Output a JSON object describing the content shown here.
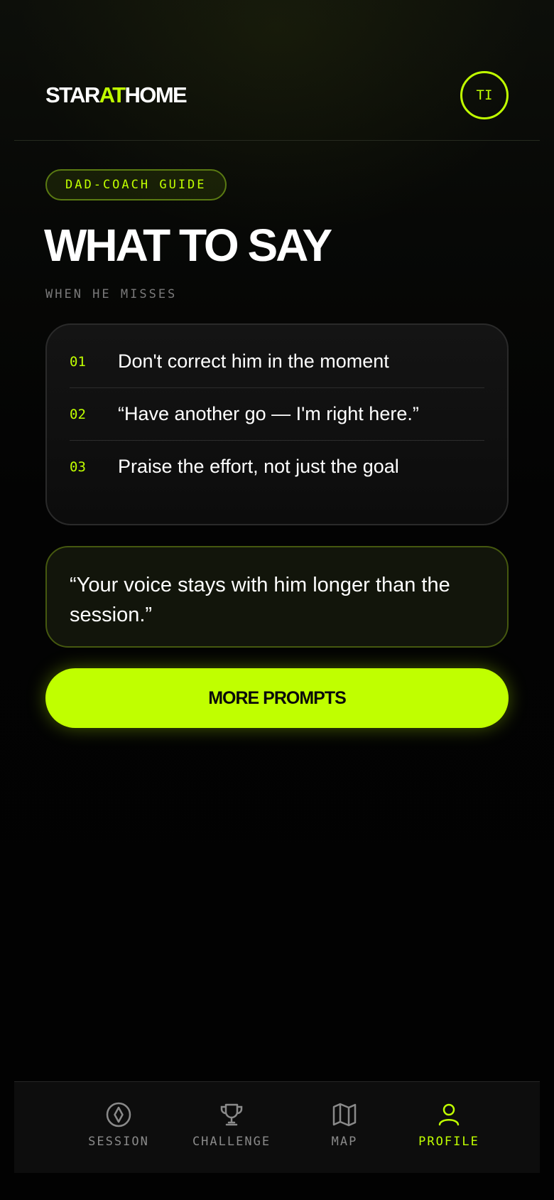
{
  "colors": {
    "accent": "#c0ff00",
    "background": "#030303",
    "muted_text": "#8a8a8a"
  },
  "header": {
    "logo_part1": "STAR",
    "logo_part2": "AT",
    "logo_part3": "HOME",
    "avatar_initials": "TI"
  },
  "main": {
    "badge": "DAD-COACH GUIDE",
    "title": "WHAT TO SAY",
    "subtitle": "WHEN HE MISSES",
    "tips": [
      {
        "num": "01",
        "text": "Don't correct him in the moment"
      },
      {
        "num": "02",
        "text": "“Have another go — I'm right here.”"
      },
      {
        "num": "03",
        "text": "Praise the effort, not just the goal"
      }
    ],
    "quote": "“Your voice stays with him longer than the session.”",
    "cta_label": "MORE PROMPTS"
  },
  "nav": {
    "items": [
      {
        "label": "SESSION",
        "icon": "compass-icon",
        "active": false
      },
      {
        "label": "CHALLENGE",
        "icon": "trophy-icon",
        "active": false
      },
      {
        "label": "MAP",
        "icon": "map-icon",
        "active": false
      },
      {
        "label": "PROFILE",
        "icon": "user-icon",
        "active": true
      }
    ]
  }
}
